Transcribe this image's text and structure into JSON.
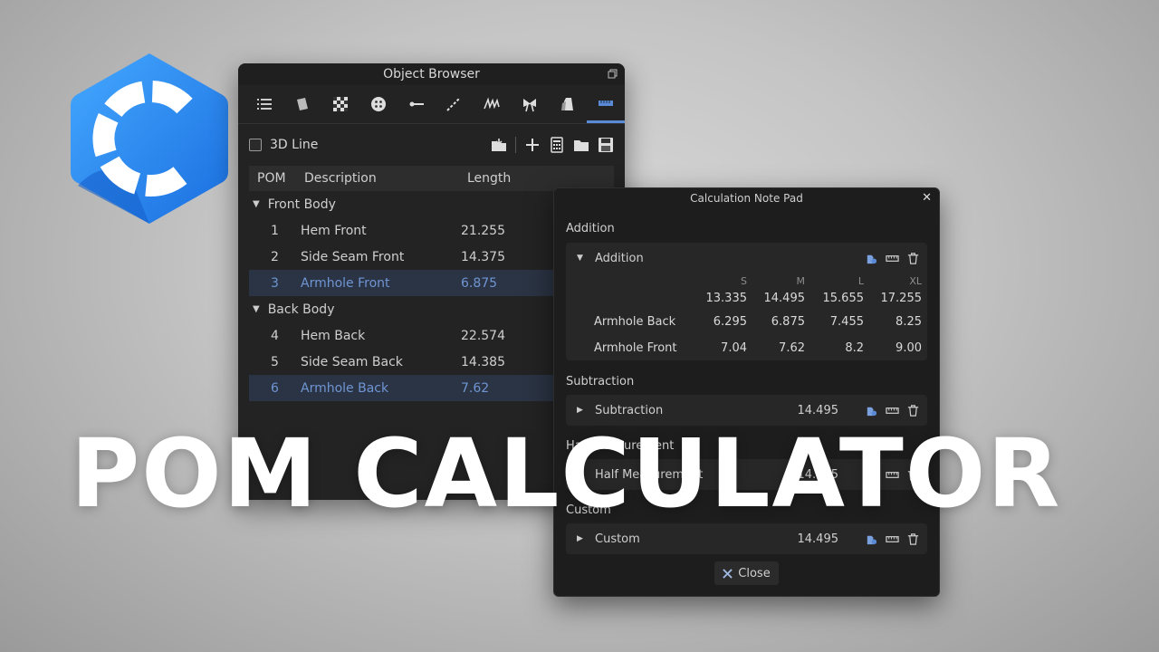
{
  "colors": {
    "accent": "#5a8ad6",
    "selected_text": "#6f95d3",
    "logo_blue": "#2f8ff5"
  },
  "object_browser": {
    "title": "Object Browser",
    "toolbar_icons": [
      "list-icon",
      "fabric-icon",
      "checker-icon",
      "button-icon",
      "line-icon",
      "dashed-line-icon",
      "stitch-icon",
      "bow-icon",
      "garment-icon",
      "ruler-icon"
    ],
    "checkbox_label": "3D Line",
    "columns": {
      "pom": "POM",
      "description": "Description",
      "length": "Length"
    },
    "groups": [
      {
        "name": "Front Body",
        "items": [
          {
            "num": "1",
            "desc": "Hem Front",
            "length": "21.255",
            "selected": false
          },
          {
            "num": "2",
            "desc": "Side Seam Front",
            "length": "14.375",
            "selected": false
          },
          {
            "num": "3",
            "desc": "Armhole Front",
            "length": "6.875",
            "selected": true
          }
        ]
      },
      {
        "name": "Back Body",
        "items": [
          {
            "num": "4",
            "desc": "Hem Back",
            "length": "22.574",
            "selected": false
          },
          {
            "num": "5",
            "desc": "Side Seam Back",
            "length": "14.385",
            "selected": false
          },
          {
            "num": "6",
            "desc": "Armhole Back",
            "length": "7.62",
            "selected": true
          }
        ]
      }
    ]
  },
  "calc_pad": {
    "title": "Calculation Note Pad",
    "addition": {
      "section_label": "Addition",
      "panel_label": "Addition",
      "sizes": [
        "S",
        "M",
        "L",
        "XL"
      ],
      "totals": [
        "13.335",
        "14.495",
        "15.655",
        "17.255"
      ],
      "rows": [
        {
          "label": "Armhole Back",
          "values": [
            "6.295",
            "6.875",
            "7.455",
            "8.25"
          ]
        },
        {
          "label": "Armhole Front",
          "values": [
            "7.04",
            "7.62",
            "8.2",
            "9.00"
          ]
        }
      ]
    },
    "subtraction": {
      "section_label": "Subtraction",
      "panel_label": "Subtraction",
      "value": "14.495"
    },
    "half": {
      "section_label": "Half Measurement",
      "panel_label": "Half Measurement",
      "value": "14.495"
    },
    "custom": {
      "section_label": "Custom",
      "panel_label": "Custom",
      "value": "14.495"
    },
    "close_label": "Close"
  },
  "overlay_title": "POM CALCULATOR"
}
